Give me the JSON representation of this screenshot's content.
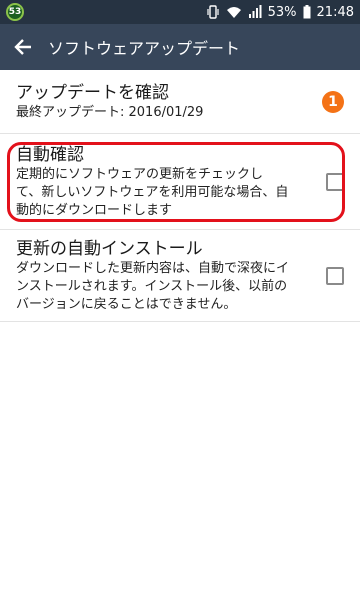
{
  "status_bar": {
    "notification_count": "53",
    "battery": "53%",
    "time": "21:48"
  },
  "app_bar": {
    "title": "ソフトウェアアップデート"
  },
  "settings": [
    {
      "title": "アップデートを確認",
      "subtitle": "最終アップデート: 2016/01/29",
      "badge": "1"
    },
    {
      "title": "自動確認",
      "description_lines": [
        "定期的にソフトウェアの更新をチェックし",
        "て、新しいソフトウェアを利用可能な場合、自",
        "動的にダウンロードします"
      ],
      "checked": false,
      "highlighted": true
    },
    {
      "title": "更新の自動インストール",
      "description_lines": [
        "ダウンロードした更新内容は、自動で深夜にイ",
        "ンストールされます。インストール後、以前の",
        "バージョンに戻ることはできません。"
      ],
      "checked": false
    }
  ],
  "colors": {
    "status_bar": "#263342",
    "app_bar": "#37465a",
    "badge": "#f47216",
    "highlight": "#e3111b"
  }
}
